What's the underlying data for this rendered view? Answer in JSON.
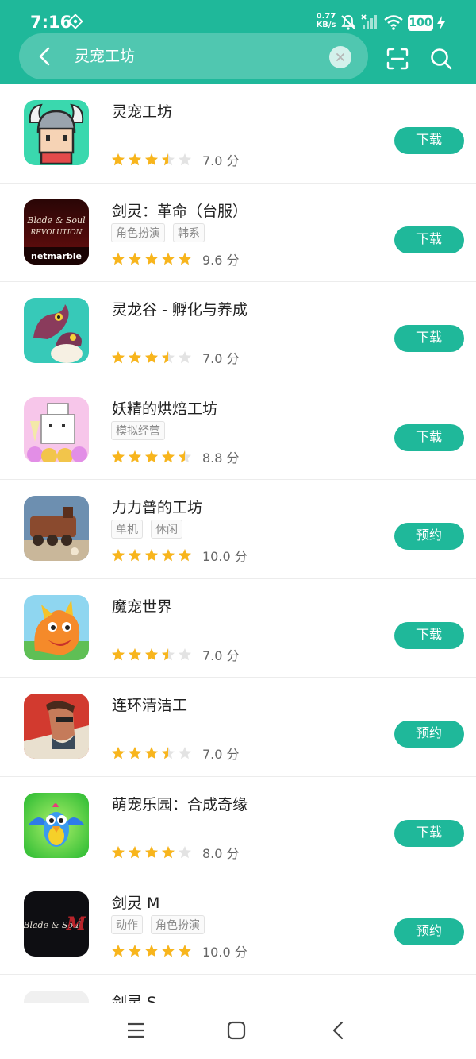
{
  "status": {
    "time": "7:16",
    "speed_value": "0.77",
    "speed_unit": "KB/s",
    "battery": "100",
    "icons": [
      "nfc-icon",
      "mute-icon",
      "no-signal-icon",
      "wifi-icon",
      "charging-icon"
    ]
  },
  "search": {
    "query": "灵宠工坊",
    "back_icon": "back-arrow-icon",
    "clear_icon": "clear-icon",
    "scan_icon": "scan-icon",
    "search_icon": "search-icon"
  },
  "colors": {
    "accent": "#1fb89a",
    "star": "#f8b51c",
    "star_empty": "#e3e3e3"
  },
  "apps": [
    {
      "name": "灵宠工坊",
      "tags": [],
      "stars": 3.5,
      "score": "7.0 分",
      "button": "下载"
    },
    {
      "name": "剑灵：革命（台服）",
      "tags": [
        "角色扮演",
        "韩系"
      ],
      "stars": 5,
      "score": "9.6 分",
      "button": "下载",
      "icon_text": [
        "Blade & Soul",
        "REVOLUTION",
        "netmarble"
      ]
    },
    {
      "name": "灵龙谷 - 孵化与养成",
      "tags": [],
      "stars": 3.5,
      "score": "7.0 分",
      "button": "下载"
    },
    {
      "name": "妖精的烘焙工坊",
      "tags": [
        "模拟经营"
      ],
      "stars": 4.5,
      "score": "8.8 分",
      "button": "下载"
    },
    {
      "name": "力力普的工坊",
      "tags": [
        "单机",
        "休闲"
      ],
      "stars": 5,
      "score": "10.0 分",
      "button": "预约"
    },
    {
      "name": "魔宠世界",
      "tags": [],
      "stars": 3.5,
      "score": "7.0 分",
      "button": "下载"
    },
    {
      "name": "连环清洁工",
      "tags": [],
      "stars": 3.5,
      "score": "7.0 分",
      "button": "预约"
    },
    {
      "name": "萌宠乐园：合成奇缘",
      "tags": [],
      "stars": 4,
      "score": "8.0 分",
      "button": "下载"
    },
    {
      "name": "剑灵 M",
      "tags": [
        "动作",
        "角色扮演"
      ],
      "stars": 5,
      "score": "10.0 分",
      "button": "预约",
      "icon_text": [
        "Blade & Soul",
        "M"
      ]
    },
    {
      "name": "剑灵 S",
      "tags": [],
      "stars": 0,
      "score": "",
      "button": ""
    }
  ],
  "navbar": [
    "menu-icon",
    "home-icon",
    "back-icon"
  ]
}
